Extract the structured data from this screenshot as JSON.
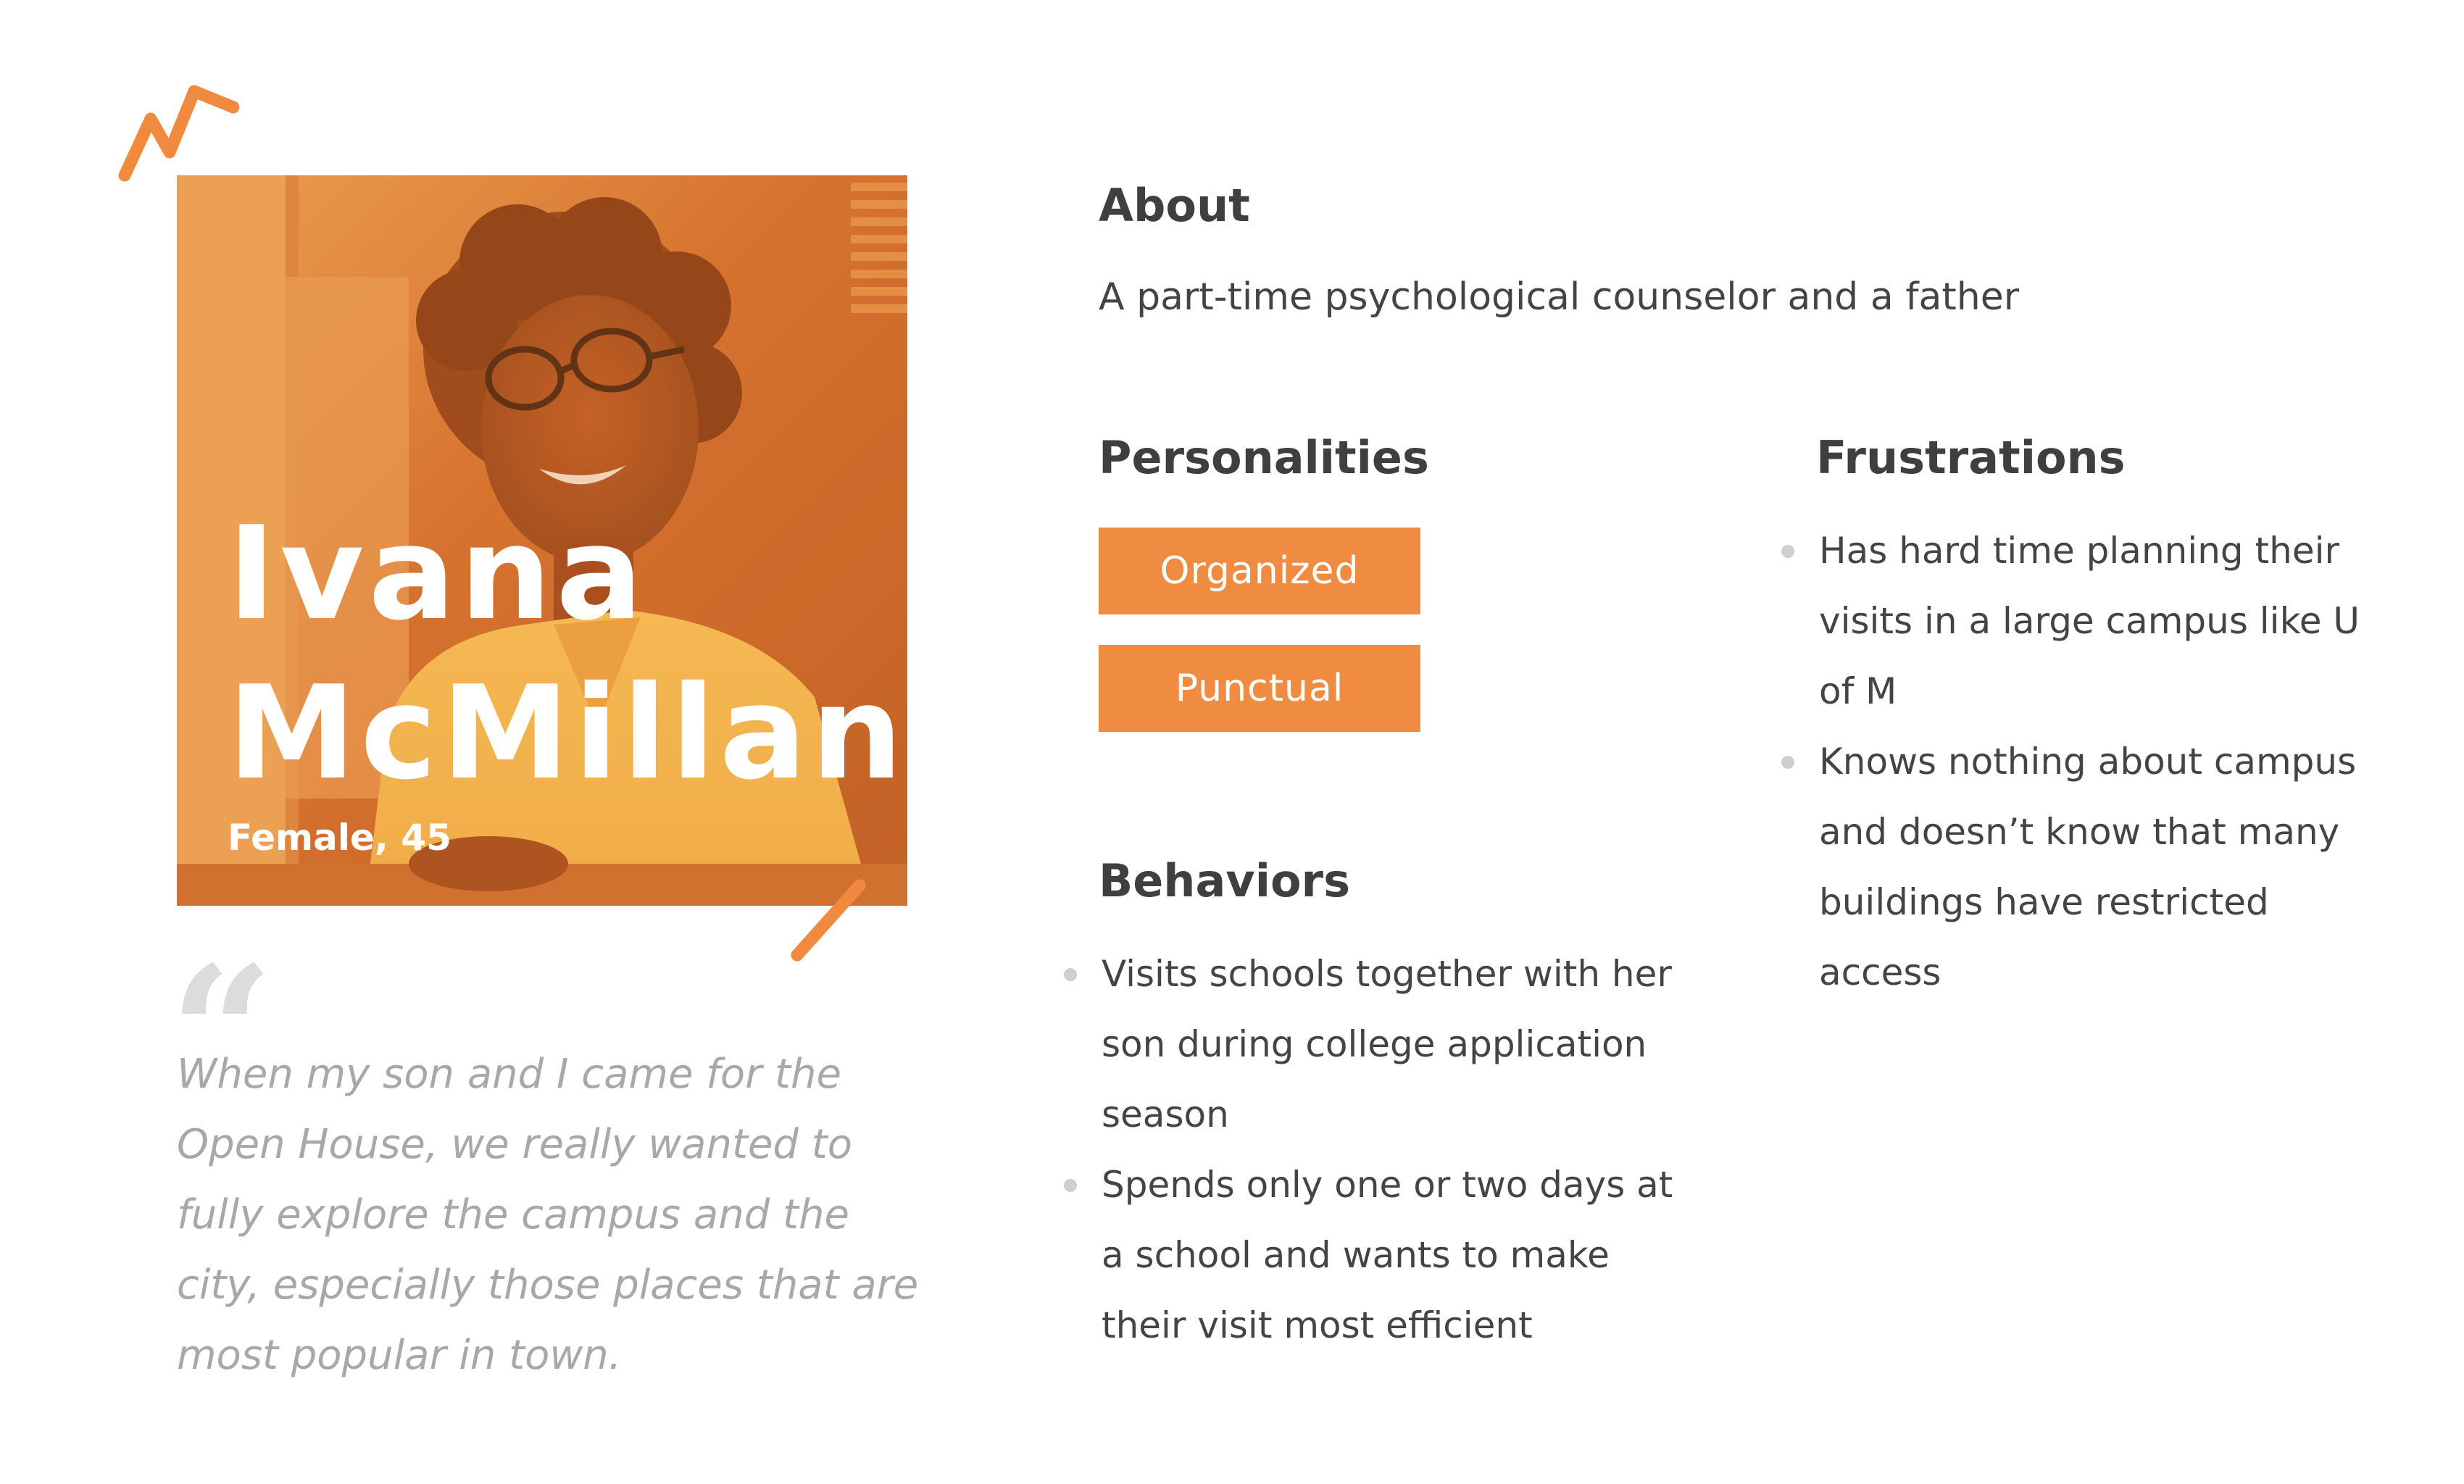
{
  "persona": {
    "first_name": "Ivana",
    "last_name": "McMillan",
    "meta": "Female, 45",
    "photo_icon": "person-photo",
    "quote_icon": "quote-mark-icon",
    "quote_glyph": "“",
    "quote": "When my son and I came for the Open House, we really wanted to fully explore the campus and the city, especially those places that are most popular in town."
  },
  "about": {
    "heading": "About",
    "text": "A part-time psychological counselor and a father"
  },
  "personalities": {
    "heading": "Personalities",
    "tags": [
      "Organized",
      "Punctual"
    ]
  },
  "behaviors": {
    "heading": "Behaviors",
    "items": [
      "Visits schools together with her son during college application season",
      "Spends only one or two days at a school and wants to make their visit most efficient"
    ]
  },
  "frustrations": {
    "heading": "Frustrations",
    "items": [
      "Has hard time planning their visits in a large campus like U of M",
      "Knows nothing about campus and doesn’t know that many buildings have restricted access"
    ]
  },
  "colors": {
    "accent": "#f08c41",
    "heading": "#3f3f3f",
    "body": "#444444",
    "quote": "#a8a8a8",
    "bullet": "#cfcfcf"
  }
}
